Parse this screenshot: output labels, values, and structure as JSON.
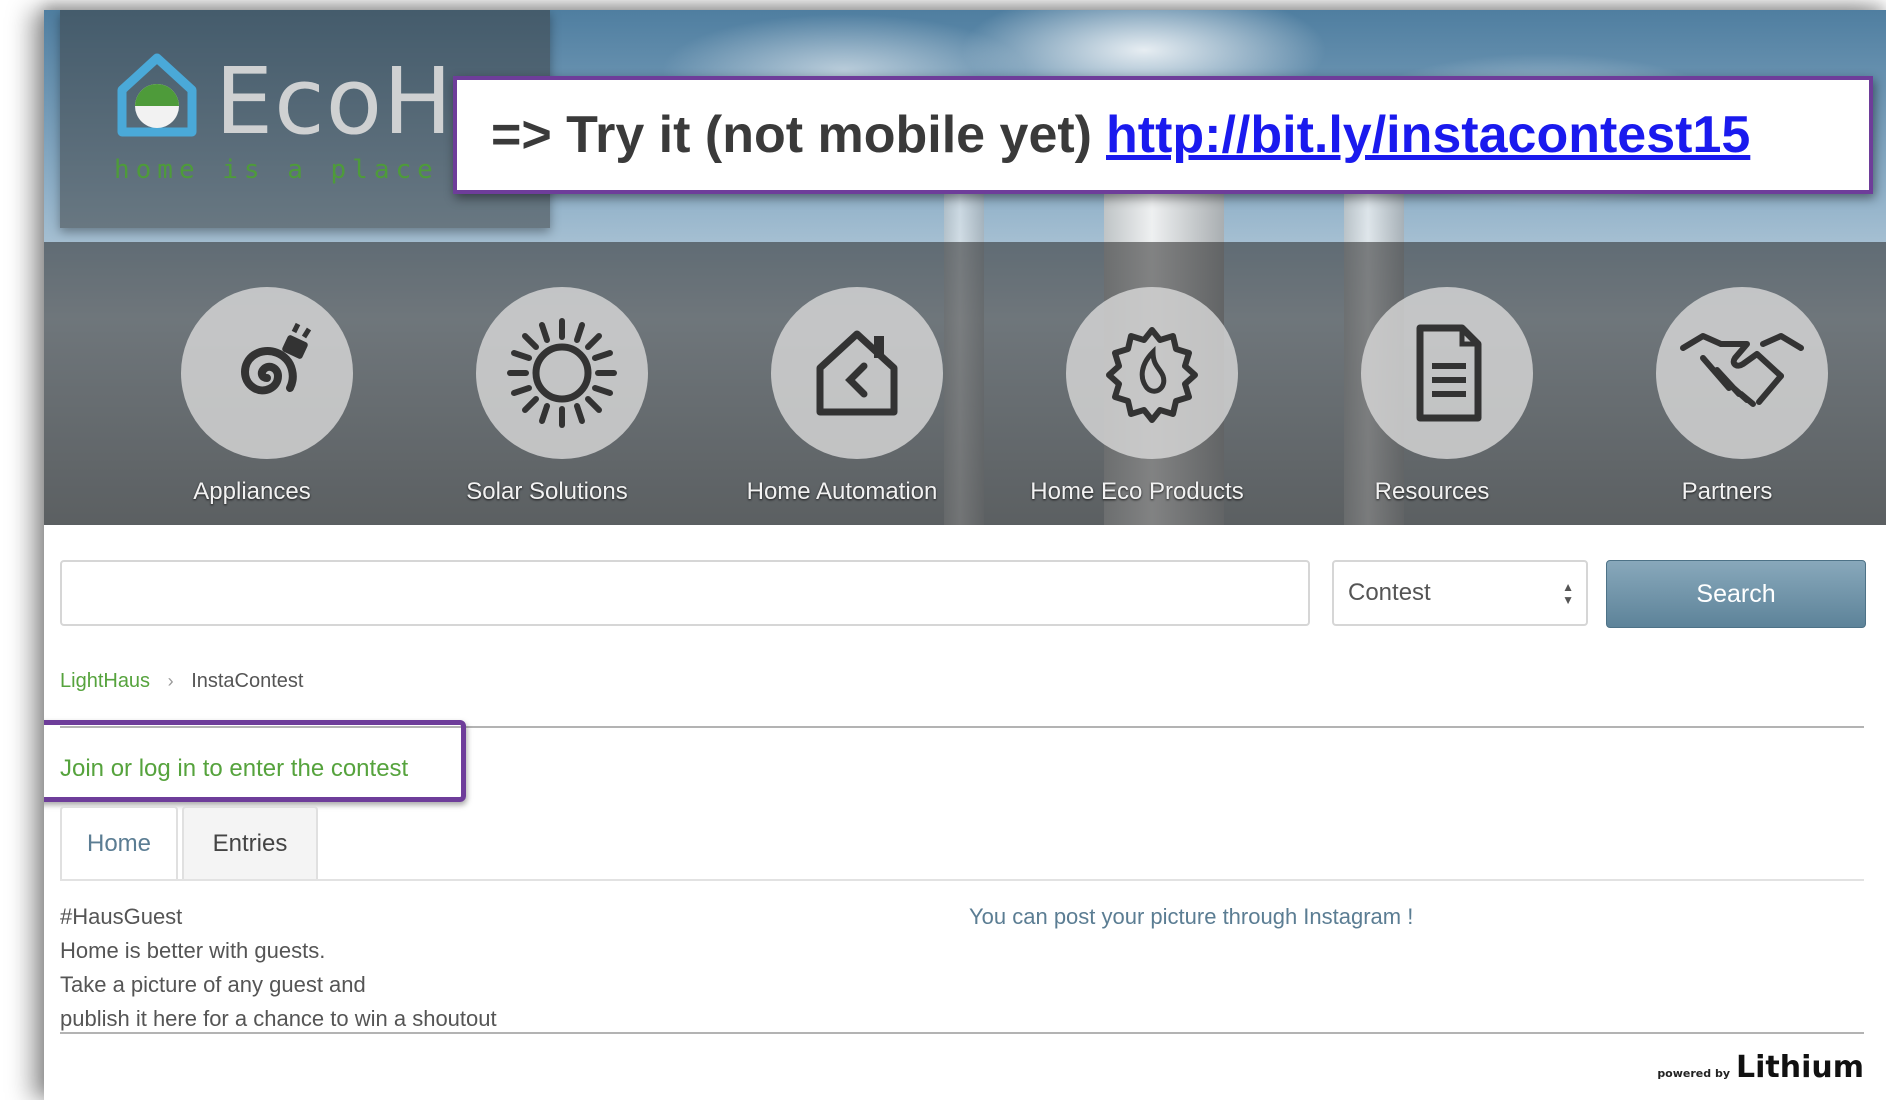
{
  "header": {
    "logo_text": "EcoHa",
    "logo_tagline": "home is a place or",
    "nav_items": [
      {
        "label": "Appliances",
        "icon": "plug-cord-icon"
      },
      {
        "label": "Solar Solutions",
        "icon": "sun-icon"
      },
      {
        "label": "Home Automation",
        "icon": "house-icon"
      },
      {
        "label": "Home Eco Products",
        "icon": "eco-badge-icon"
      },
      {
        "label": "Resources",
        "icon": "document-icon"
      },
      {
        "label": "Partners",
        "icon": "handshake-icon"
      }
    ]
  },
  "callout": {
    "prefix": "=> Try it (not mobile yet)",
    "link_text": "http://bit.ly/instacontest15"
  },
  "search": {
    "input_value": "",
    "scope_selected": "Contest",
    "button_label": "Search"
  },
  "breadcrumb": {
    "items": [
      "LightHaus",
      "InstaContest"
    ]
  },
  "join_link": "Join or log in to enter the contest",
  "tabs": [
    {
      "label": "Home",
      "active": true
    },
    {
      "label": "Entries",
      "active": false
    }
  ],
  "content": {
    "description_lines": [
      "#HausGuest",
      "Home is better with guests.",
      "Take a picture of any guest and",
      "publish it here for a chance to win a shoutout"
    ],
    "instagram_note": "You can post your picture through Instagram !"
  },
  "footer": {
    "powered_by_small": "powered by",
    "powered_by_brand": "Lithium"
  },
  "colors": {
    "accent_green": "#56a33d",
    "annotation_purple": "#6e3d9a",
    "search_button": "#6f93a8",
    "link_blue": "#1a1aee"
  }
}
